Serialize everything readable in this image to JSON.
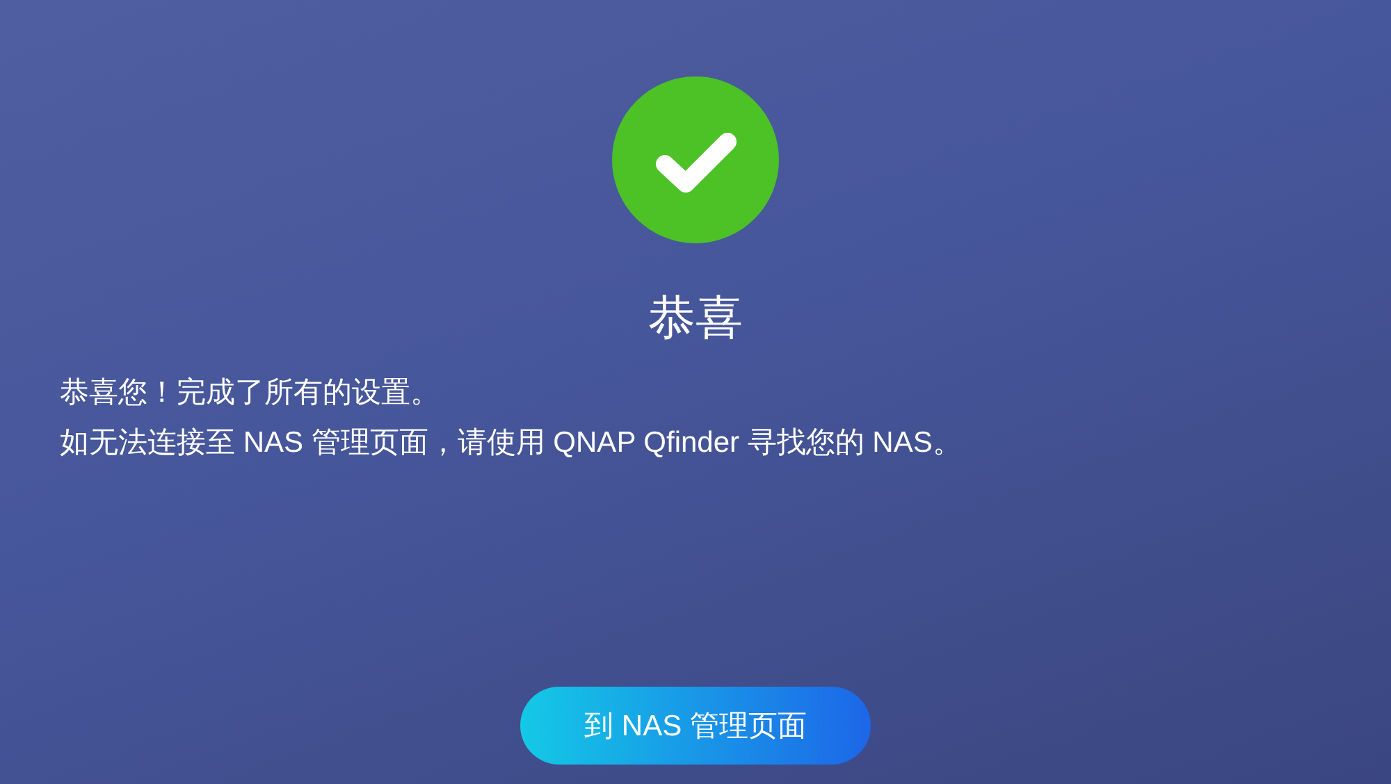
{
  "title": "恭喜",
  "messages": [
    "恭喜您！完成了所有的设置。",
    "如无法连接至 NAS 管理页面，请使用 QNAP Qfinder 寻找您的 NAS。"
  ],
  "button": {
    "label": "到 NAS 管理页面"
  }
}
